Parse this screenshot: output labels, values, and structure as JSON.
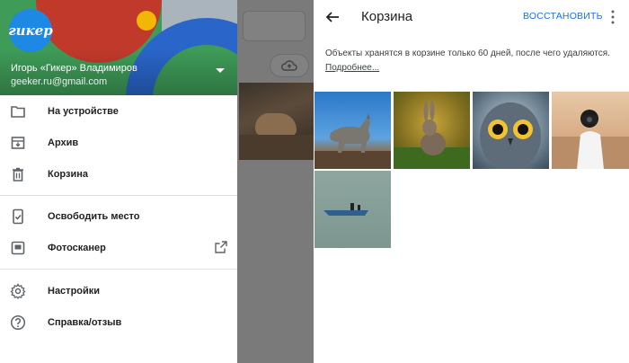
{
  "drawer": {
    "avatar_text": "гикер",
    "account_name": "Игорь «Гикер» Владимиров",
    "account_email": "geeker.ru@gmail.com",
    "items": [
      {
        "label": "На устройстве",
        "icon": "folder-icon"
      },
      {
        "label": "Архив",
        "icon": "archive-icon"
      },
      {
        "label": "Корзина",
        "icon": "trash-icon"
      },
      {
        "label": "Освободить место",
        "icon": "phone-free-space-icon"
      },
      {
        "label": "Фотосканер",
        "icon": "photoscan-icon",
        "trailing_icon": "external-link-icon"
      },
      {
        "label": "Настройки",
        "icon": "gear-icon"
      },
      {
        "label": "Справка/отзыв",
        "icon": "help-icon"
      }
    ]
  },
  "trash": {
    "title": "Корзина",
    "restore_label": "ВОССТАНОВИТЬ",
    "info_text": "Объекты хранятся в корзине только 60 дней, после чего удаляются.",
    "info_link": "Подробнее...",
    "photos": [
      {
        "subject": "wolf"
      },
      {
        "subject": "rabbit"
      },
      {
        "subject": "owl"
      },
      {
        "subject": "woman-with-camera"
      },
      {
        "subject": "boat"
      }
    ]
  },
  "colors": {
    "accent": "#1a73e8",
    "avatar": "#1e88e5",
    "scrim": "#8b8b8b"
  }
}
